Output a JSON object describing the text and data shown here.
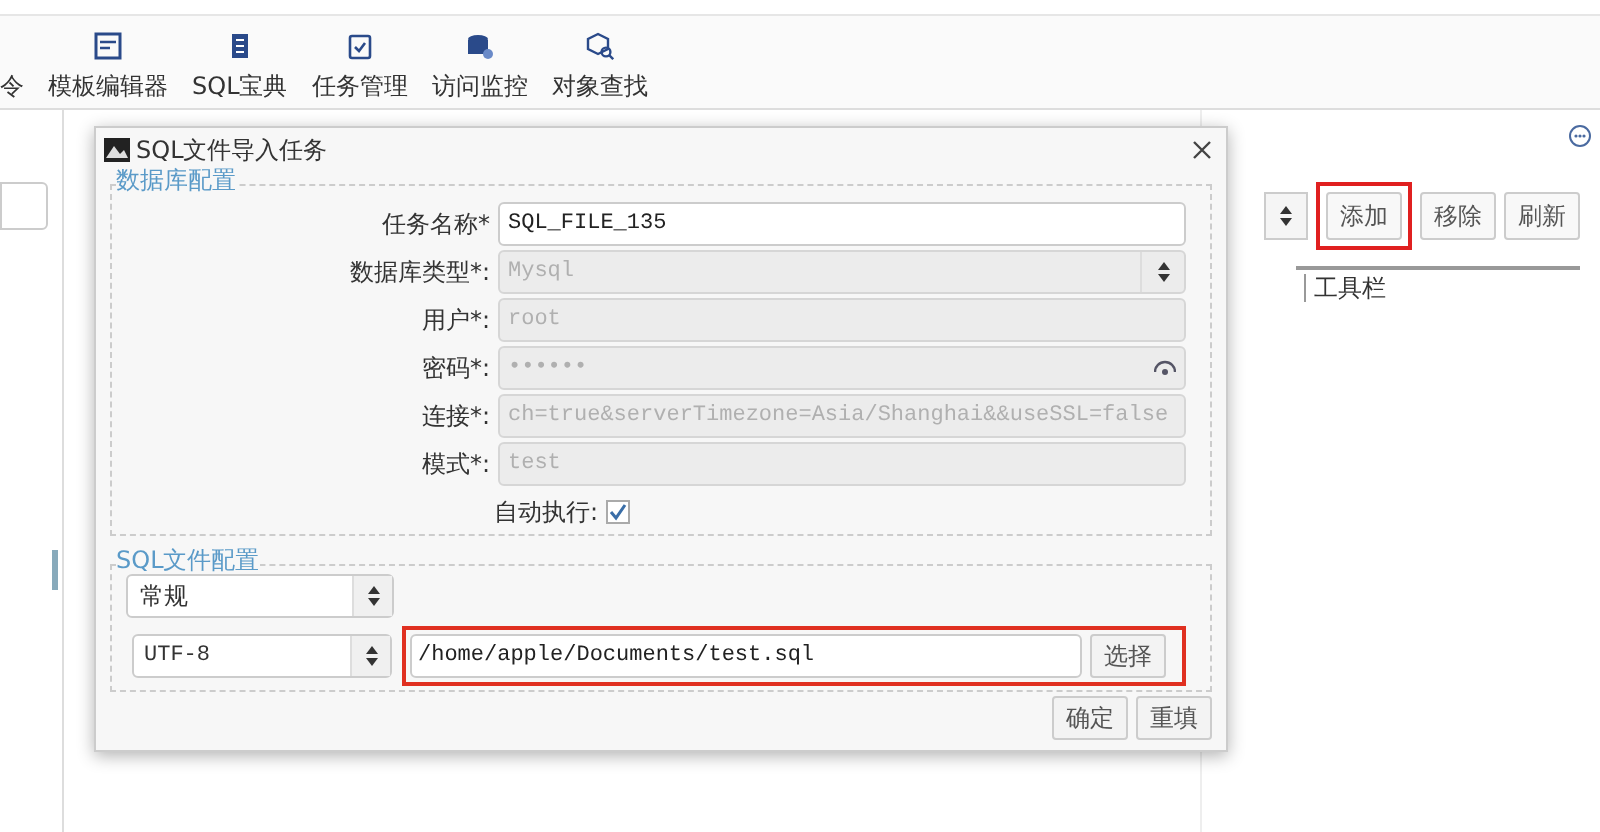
{
  "toolbar": [
    {
      "label": "令"
    },
    {
      "label": "模板编辑器"
    },
    {
      "label": "SQL宝典"
    },
    {
      "label": "任务管理"
    },
    {
      "label": "访问监控"
    },
    {
      "label": "对象查找"
    }
  ],
  "right_panel": {
    "buttons": [
      {
        "label": "添加",
        "highlighted": true
      },
      {
        "label": "移除",
        "highlighted": false
      },
      {
        "label": "刷新",
        "highlighted": false
      }
    ],
    "column_header": "工具栏"
  },
  "dialog": {
    "title": "SQL文件导入任务",
    "db_section": {
      "legend": "数据库配置",
      "fields": [
        {
          "kind": "text",
          "label": "任务名称*",
          "value": "SQL_FILE_135",
          "disabled": false
        },
        {
          "kind": "select",
          "label": "数据库类型*:",
          "value": "Mysql",
          "disabled": true
        },
        {
          "kind": "text",
          "label": "用户*:",
          "value": "root",
          "disabled": true
        },
        {
          "kind": "password",
          "label": "密码*:",
          "value": "••••••",
          "disabled": true
        },
        {
          "kind": "text",
          "label": "连接*:",
          "value": "ch=true&serverTimezone=Asia/Shanghai&&useSSL=false",
          "disabled": true
        },
        {
          "kind": "text",
          "label": "模式*:",
          "value": "test",
          "disabled": true
        },
        {
          "kind": "checkbox",
          "label": "自动执行:",
          "checked": true
        }
      ]
    },
    "file_section": {
      "legend": "SQL文件配置",
      "mode": "常规",
      "encoding": "UTF-8",
      "path": "/home/apple/Documents/test.sql",
      "choose_button": "选择",
      "highlighted": true
    },
    "buttons": [
      "确定",
      "重填"
    ]
  }
}
